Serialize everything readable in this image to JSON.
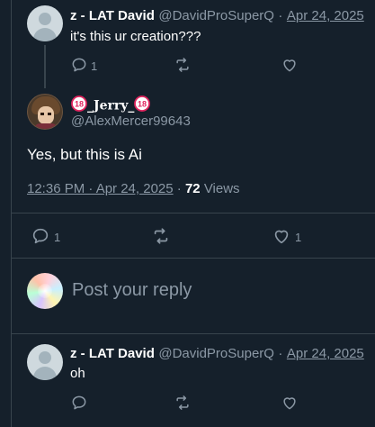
{
  "tweet_top": {
    "author_name": "z - LAT David",
    "handle": "@DavidProSuperQ",
    "separator": "·",
    "date": "Apr 24, 2025",
    "text": "it's this ur creation???",
    "reply_count": "1"
  },
  "main_tweet": {
    "author_name": "_Jerry_",
    "badge_text": "18",
    "handle": "@AlexMercer99643",
    "text": "Yes, but this is Ai",
    "time_date": "12:36 PM · Apr 24, 2025",
    "separator": "·",
    "views_count": "72",
    "views_label": "Views",
    "reply_count": "1",
    "like_count": "1"
  },
  "composer": {
    "placeholder": "Post your reply"
  },
  "tweet_bottom": {
    "author_name": "z - LAT David",
    "handle": "@DavidProSuperQ",
    "separator": "·",
    "date": "Apr 24, 2025",
    "text": "oh"
  },
  "icons": {
    "reply": "reply-icon",
    "retweet": "retweet-icon",
    "like": "heart-icon",
    "age_badge": "18-plus-icon"
  },
  "colors": {
    "background": "#15202b",
    "border": "#38444d",
    "text_primary": "#ffffff",
    "text_secondary": "#8b98a5",
    "badge_red": "#e0245e"
  }
}
